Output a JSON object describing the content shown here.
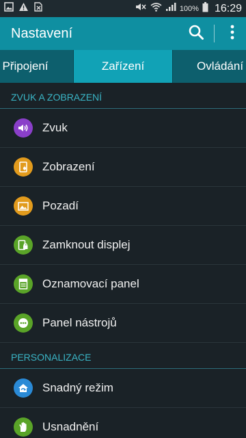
{
  "status_bar": {
    "icons_left": [
      "gallery-icon",
      "warning-icon",
      "no-sim-icon"
    ],
    "icons_right": [
      "mute-icon",
      "wifi-icon",
      "signal-icon",
      "battery-icon"
    ],
    "battery_percent": "100%",
    "time": "16:29"
  },
  "action_bar": {
    "title": "Nastavení",
    "search_icon": "search-icon",
    "menu_icon": "more-vert-icon"
  },
  "tabs": [
    {
      "label": "Připojení",
      "selected": false
    },
    {
      "label": "Zařízení",
      "selected": true
    },
    {
      "label": "Ovládání",
      "selected": false
    }
  ],
  "sections": [
    {
      "header": "ZVUK A ZOBRAZENÍ",
      "items": [
        {
          "label": "Zvuk",
          "icon": "sound-icon",
          "color": "#8a3fc9"
        },
        {
          "label": "Zobrazení",
          "icon": "display-icon",
          "color": "#e29b1d"
        },
        {
          "label": "Pozadí",
          "icon": "wallpaper-icon",
          "color": "#e29b1d"
        },
        {
          "label": "Zamknout displej",
          "icon": "lock-screen-icon",
          "color": "#5aa428"
        },
        {
          "label": "Oznamovací panel",
          "icon": "notification-panel-icon",
          "color": "#5aa428"
        },
        {
          "label": "Panel nástrojů",
          "icon": "toolbox-icon",
          "color": "#5aa428"
        }
      ]
    },
    {
      "header": "PERSONALIZACE",
      "items": [
        {
          "label": "Snadný režim",
          "icon": "easy-mode-icon",
          "color": "#2a8ad6"
        },
        {
          "label": "Usnadnění",
          "icon": "accessibility-icon",
          "color": "#5aa428"
        }
      ]
    }
  ],
  "colors": {
    "action_bar": "#0f8fa1",
    "tab_bar": "#0d5f6d",
    "tab_selected": "#11a2b6",
    "background": "#1a2227",
    "section_header_text": "#3ab5c6"
  }
}
